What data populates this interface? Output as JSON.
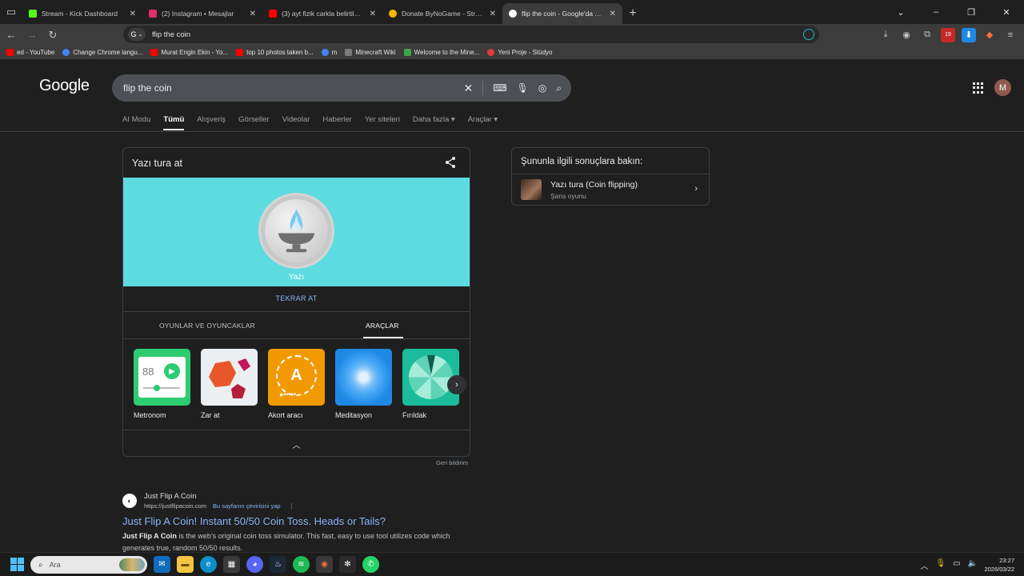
{
  "browser": {
    "tabs": [
      {
        "title": "Stream - Kick Dashboard",
        "color": "#53fc18"
      },
      {
        "title": "(2) Instagram • Mesajlar",
        "color": "#e1306c"
      },
      {
        "title": "(3) ayt fizik carkla belirtiler - YouTube",
        "color": "#ff0000"
      },
      {
        "title": "Donate ByNoGame - Streamer Sayfası",
        "color": "#f5b700"
      },
      {
        "title": "flip the coin - Google'da Ara",
        "color": "#4285f4"
      }
    ],
    "address": "flip the coin",
    "omni_g": "G",
    "ext_badge": "19",
    "bookmarks": [
      {
        "label": "ed - YouTube",
        "color": "#ff0000"
      },
      {
        "label": "Change Chrome langu...",
        "color": "#4285f4"
      },
      {
        "label": "Murat Engin Ekin - Yo...",
        "color": "#ff0000"
      },
      {
        "label": "top 10 photos taken b...",
        "color": "#ff0000"
      },
      {
        "label": "m",
        "color": "#4285f4"
      },
      {
        "label": "Minecraft Wiki",
        "color": "#7a7a7a"
      },
      {
        "label": "Welcome to the Mine...",
        "color": "#3fa34d"
      },
      {
        "label": "Yeni Proje - Stüdyo",
        "color": "#e53935"
      }
    ]
  },
  "google": {
    "logo": "Google",
    "query": "flip the coin",
    "avatar": "M",
    "nav": [
      "AI Modu",
      "Tümü",
      "Alışveriş",
      "Görseller",
      "Videolar",
      "Haberler",
      "Yer siteleri",
      "Daha fazla",
      "Araçlar"
    ],
    "card": {
      "title": "Yazı tura at",
      "coin_label": "Yazı",
      "retry": "TEKRAR AT",
      "tab_games": "OYUNLAR VE OYUNCAKLAR",
      "tab_tools": "ARAÇLAR",
      "tools": [
        "Metronom",
        "Zar at",
        "Akort aracı",
        "Meditasyon",
        "Fırıldak"
      ],
      "metronome_value": "88",
      "tuner_letter": "A"
    },
    "feedback": "Geri bildirim",
    "side": {
      "heading": "Şununla ilgili sonuçlara bakın:",
      "title": "Yazı tura (Coin flipping)",
      "subtitle": "Şans oyunu"
    },
    "result": {
      "site": "Just Flip A Coin",
      "url": "https://justflipacoin.com",
      "translate": "Bu sayfanın çevirisini yap",
      "title": "Just Flip A Coin! Instant 50/50 Coin Toss. Heads or Tails?",
      "snippet_bold": "Just Flip A Coin",
      "snippet": " is the web's original coin toss simulator. This fast, easy to use tool utilizes code which generates true, random 50/50 results."
    }
  },
  "taskbar": {
    "search_placeholder": "Ara",
    "time": "23:27",
    "date": "2026/03/22"
  }
}
